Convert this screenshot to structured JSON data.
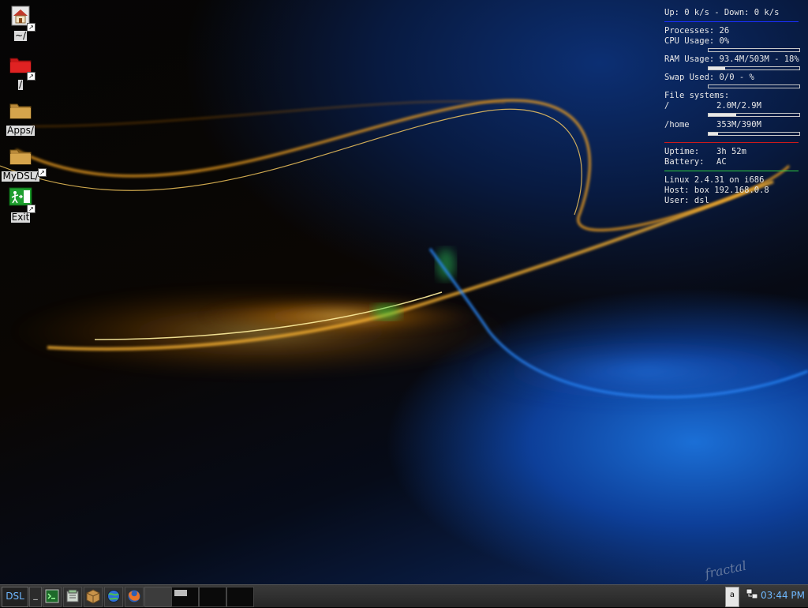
{
  "desktop": {
    "icons": [
      {
        "label": "~/",
        "icon": "home-folder-icon"
      },
      {
        "label": "/",
        "icon": "red-folder-icon"
      },
      {
        "label": "Apps/",
        "icon": "folder-icon"
      },
      {
        "label": "MyDSL/",
        "icon": "folder-icon"
      },
      {
        "label": "Exit",
        "icon": "exit-icon"
      }
    ],
    "watermark": "fractal"
  },
  "sysmon": {
    "net": "Up: 0 k/s - Down: 0 k/s",
    "processes_label": "Processes:",
    "processes": "26",
    "cpu_label": "CPU Usage:",
    "cpu": "0%",
    "cpu_level": 0,
    "ram_label": "RAM Usage:",
    "ram": "93.4M/503M - 18%",
    "ram_level": 18,
    "swap_label": "Swap Used:",
    "swap": "0/0 - %",
    "swap_level": 0,
    "fs_label": "File systems:",
    "fs_root_label": "/",
    "fs_root": "2.0M/2.9M",
    "fs_root_level": 30,
    "fs_home_label": "/home",
    "fs_home": "353M/390M",
    "fs_home_level": 10,
    "uptime_label": "Uptime:",
    "uptime": "3h 52m",
    "battery_label": "Battery:",
    "battery": "AC",
    "kernel": "Linux 2.4.31 on i686",
    "host": "Host: box 192.168.0.8",
    "user": "User: dsl",
    "colors": {
      "divider_blue": "#1a2fff",
      "divider_red": "#cc1a1a",
      "divider_green": "#2ecc40"
    }
  },
  "taskbar": {
    "start_label": "DSL",
    "show_desktop_label": "_",
    "quick_launch": [
      "terminal-icon",
      "file-manager-icon",
      "package-icon",
      "browser-icon",
      "firefox-icon"
    ],
    "keyboard_indicator": "a",
    "clock": "03:44 PM",
    "accent": "#6fb8ff"
  }
}
